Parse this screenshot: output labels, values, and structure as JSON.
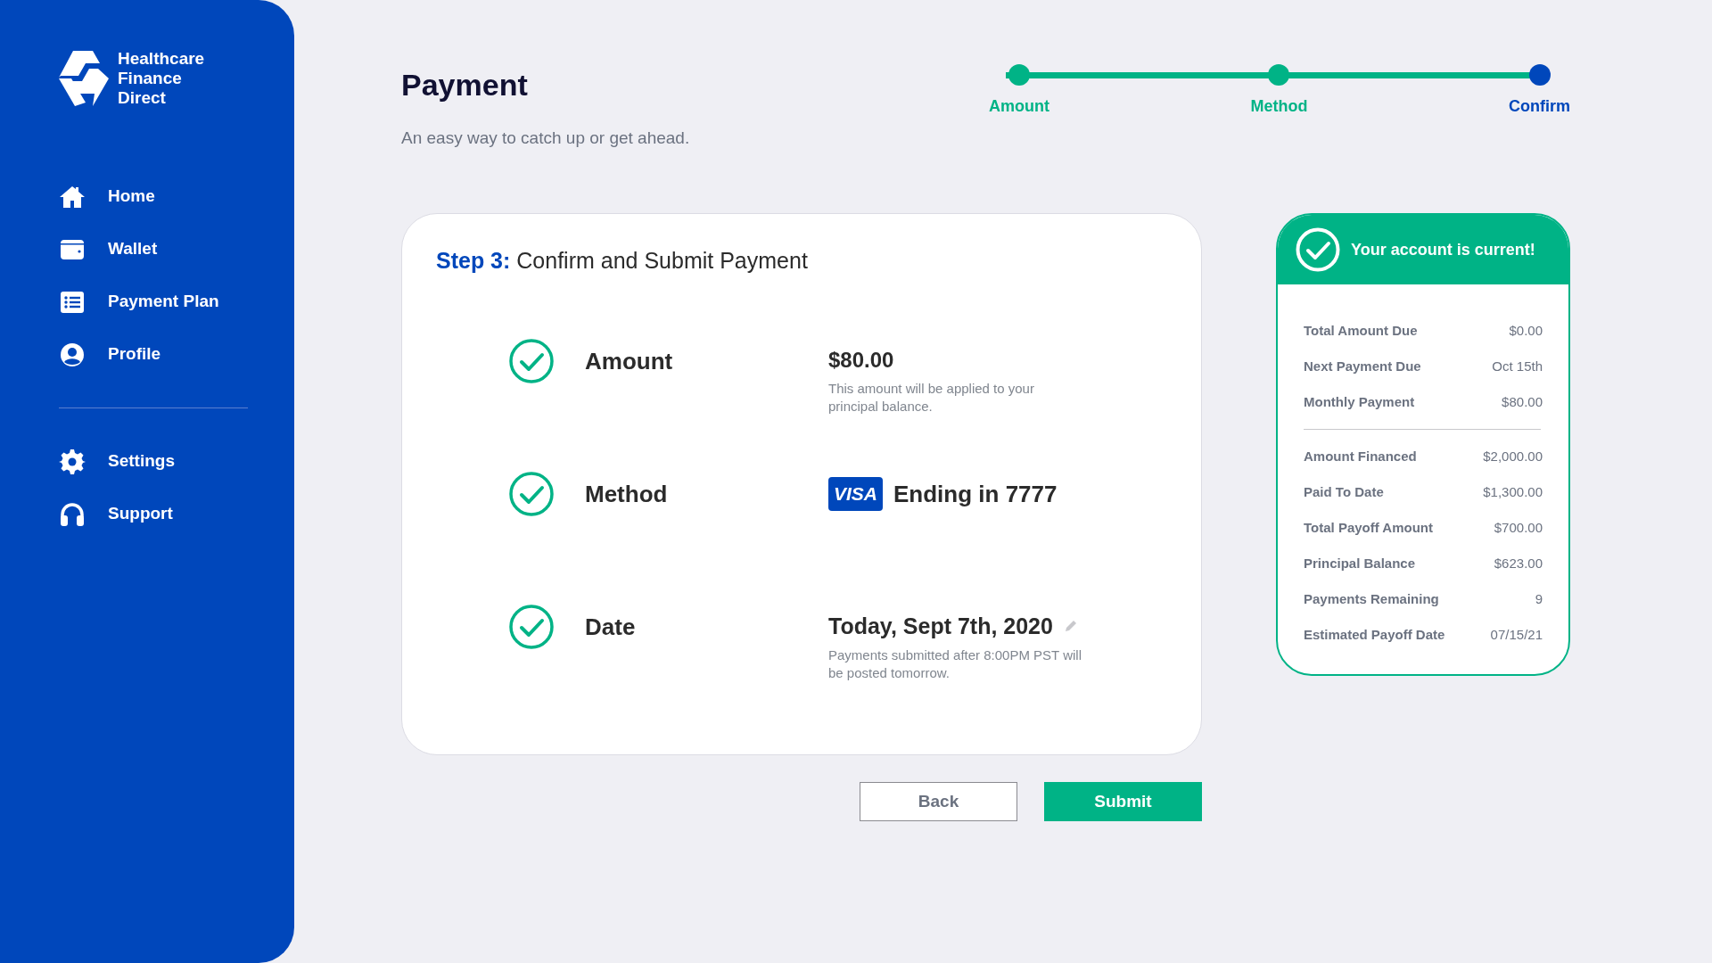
{
  "brand": {
    "lines": [
      "Healthcare",
      "Finance",
      "Direct"
    ]
  },
  "sidebar": {
    "sections": [
      [
        {
          "label": "Home"
        },
        {
          "label": "Wallet"
        },
        {
          "label": "Payment Plan"
        },
        {
          "label": "Profile"
        }
      ],
      [
        {
          "label": "Settings"
        },
        {
          "label": "Support"
        }
      ]
    ]
  },
  "header": {
    "title": "Payment",
    "subtitle": "An easy way to catch up or get ahead."
  },
  "steps": [
    {
      "label": "Amount",
      "selected": false
    },
    {
      "label": "Method",
      "selected": false
    },
    {
      "label": "Confirm",
      "selected": true
    }
  ],
  "review": {
    "step_label": "Step 3:",
    "title": "Confirm and Submit Payment",
    "rows": [
      {
        "kind": "amount",
        "label": "Amount",
        "checked": true,
        "value": "$80.00",
        "note": "This amount will be applied to your principal balance."
      },
      {
        "kind": "card",
        "label": "Method",
        "checked": true,
        "card_brand": "VISA",
        "value": "Ending in 7777"
      },
      {
        "kind": "date",
        "label": "Date",
        "checked": true,
        "value": "Today, Sept 7th, 2020",
        "note": "Payments submitted after 8:00PM PST will be posted tomorrow."
      }
    ]
  },
  "buttons": [
    {
      "label": "Back",
      "kind": "secondary"
    },
    {
      "label": "Submit",
      "kind": "primary"
    }
  ],
  "account": {
    "status": "Your account is current!",
    "groups": [
      [
        {
          "label": "Total Amount Due",
          "value": "$0.00"
        },
        {
          "label": "Next Payment Due",
          "value": "Oct 15th"
        },
        {
          "label": "Monthly Payment",
          "value": "$80.00"
        }
      ],
      [
        {
          "label": "Amount Financed",
          "value": "$2,000.00"
        },
        {
          "label": "Paid To Date",
          "value": "$1,300.00"
        },
        {
          "label": "Total Payoff Amount",
          "value": "$700.00"
        },
        {
          "label": "Principal Balance",
          "value": "$623.00"
        },
        {
          "label": "Payments Remaining",
          "value": "9"
        },
        {
          "label": "Estimated Payoff Date",
          "value": "07/15/21"
        }
      ]
    ]
  }
}
